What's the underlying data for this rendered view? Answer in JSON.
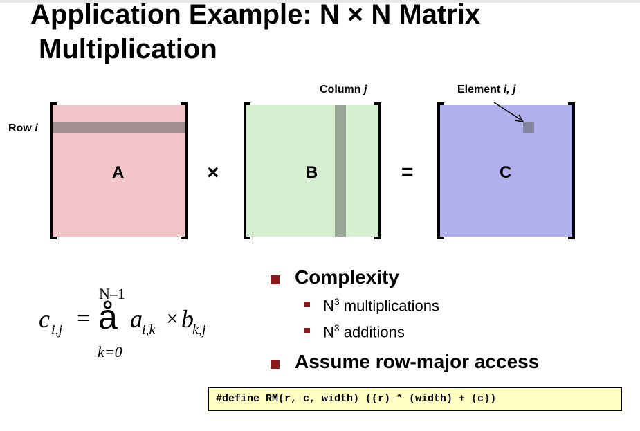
{
  "slide": {
    "title_line1": "Application Example: N × N Matrix",
    "title_line2": "Multiplication"
  },
  "diagram": {
    "matrix_a": "A",
    "matrix_b": "B",
    "matrix_c": "C",
    "times": "×",
    "equals": "=",
    "row_label": "Row ",
    "row_var": "i",
    "column_label": "Column ",
    "column_var": "j",
    "element_label": "Element ",
    "element_vars": "i, j",
    "colors": {
      "a": "#f2c6c8",
      "b": "#d6efd0",
      "c": "#b0b0ec",
      "a_row": "#a39091",
      "b_col": "#9aa897",
      "c_elem": "#8485a0"
    }
  },
  "formula": {
    "c": "c",
    "c_sub": "i,j",
    "eq": "=",
    "sigma": "å",
    "upper": "N–1",
    "lower": "k=0",
    "a": "a",
    "a_sub": "i,k",
    "dot": "×",
    "b": "b",
    "b_sub": "k,j"
  },
  "bullets": {
    "complexity": "Complexity",
    "sub1_base": "N",
    "sub1_sup": "3",
    "sub1_rest": " multiplications",
    "sub2_base": "N",
    "sub2_sup": "3",
    "sub2_rest": " additions",
    "access": "Assume row-major access"
  },
  "code": "#define RM(r, c, width) ((r) * (width) + (c))"
}
